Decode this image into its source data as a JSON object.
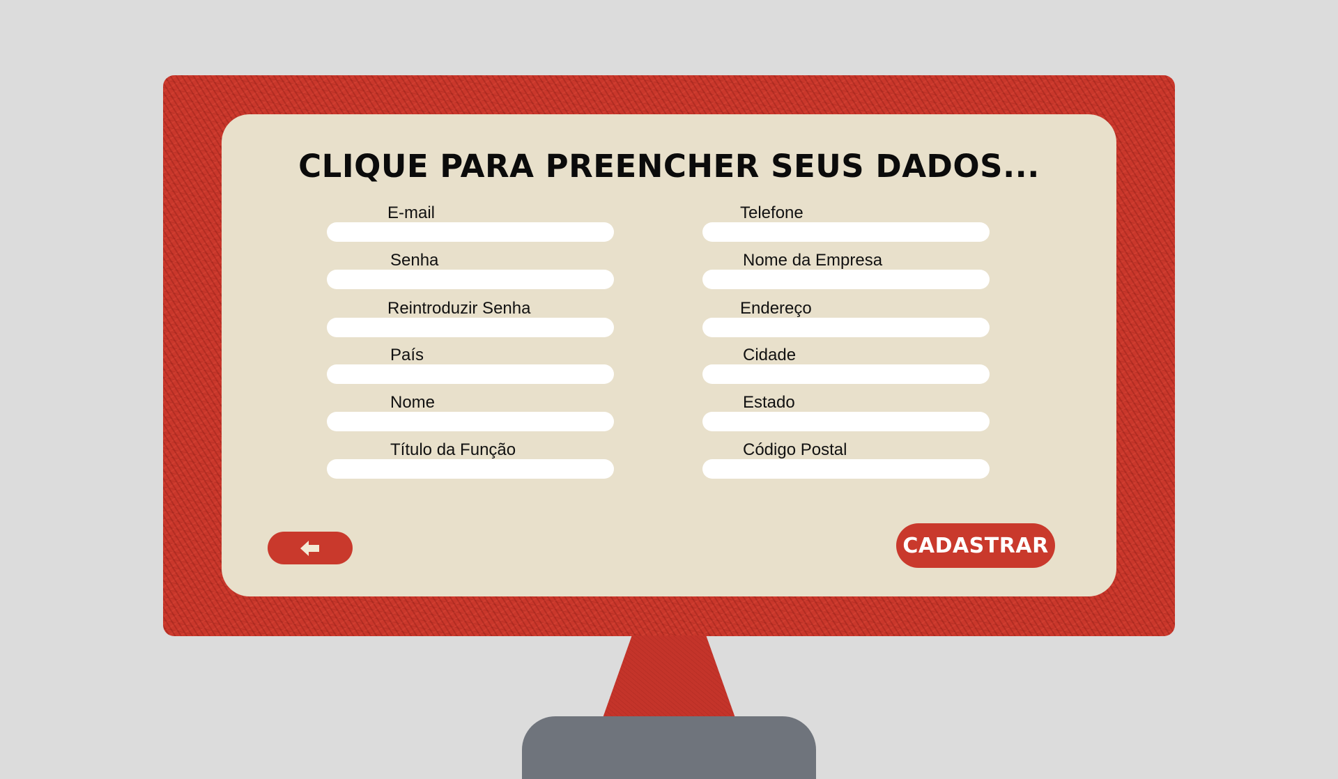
{
  "title": "CLIQUE PARA PREENCHER SEUS DADOS...",
  "form": {
    "left_fields": [
      {
        "label": "E-mail",
        "value": "",
        "placeholder": ""
      },
      {
        "label": "Senha",
        "value": "",
        "placeholder": ""
      },
      {
        "label": "Reintroduzir Senha",
        "value": "",
        "placeholder": ""
      },
      {
        "label": "País",
        "value": "",
        "placeholder": ""
      },
      {
        "label": "Nome",
        "value": "",
        "placeholder": ""
      },
      {
        "label": "Título da Função",
        "value": "",
        "placeholder": ""
      }
    ],
    "right_fields": [
      {
        "label": "Telefone",
        "value": "",
        "placeholder": ""
      },
      {
        "label": "Nome da Empresa",
        "value": "",
        "placeholder": ""
      },
      {
        "label": "Endereço",
        "value": "",
        "placeholder": ""
      },
      {
        "label": "Cidade",
        "value": "",
        "placeholder": ""
      },
      {
        "label": "Estado",
        "value": "",
        "placeholder": ""
      },
      {
        "label": "Código Postal",
        "value": "",
        "placeholder": ""
      }
    ]
  },
  "buttons": {
    "back_icon": "arrow-left-icon",
    "register_label": "CADASTRAR"
  },
  "colors": {
    "accent": "#c9392c",
    "frame": "#c9372b",
    "panel": "#e8e0cb",
    "background": "#dcdcdc",
    "stand_base": "#6f747c"
  }
}
